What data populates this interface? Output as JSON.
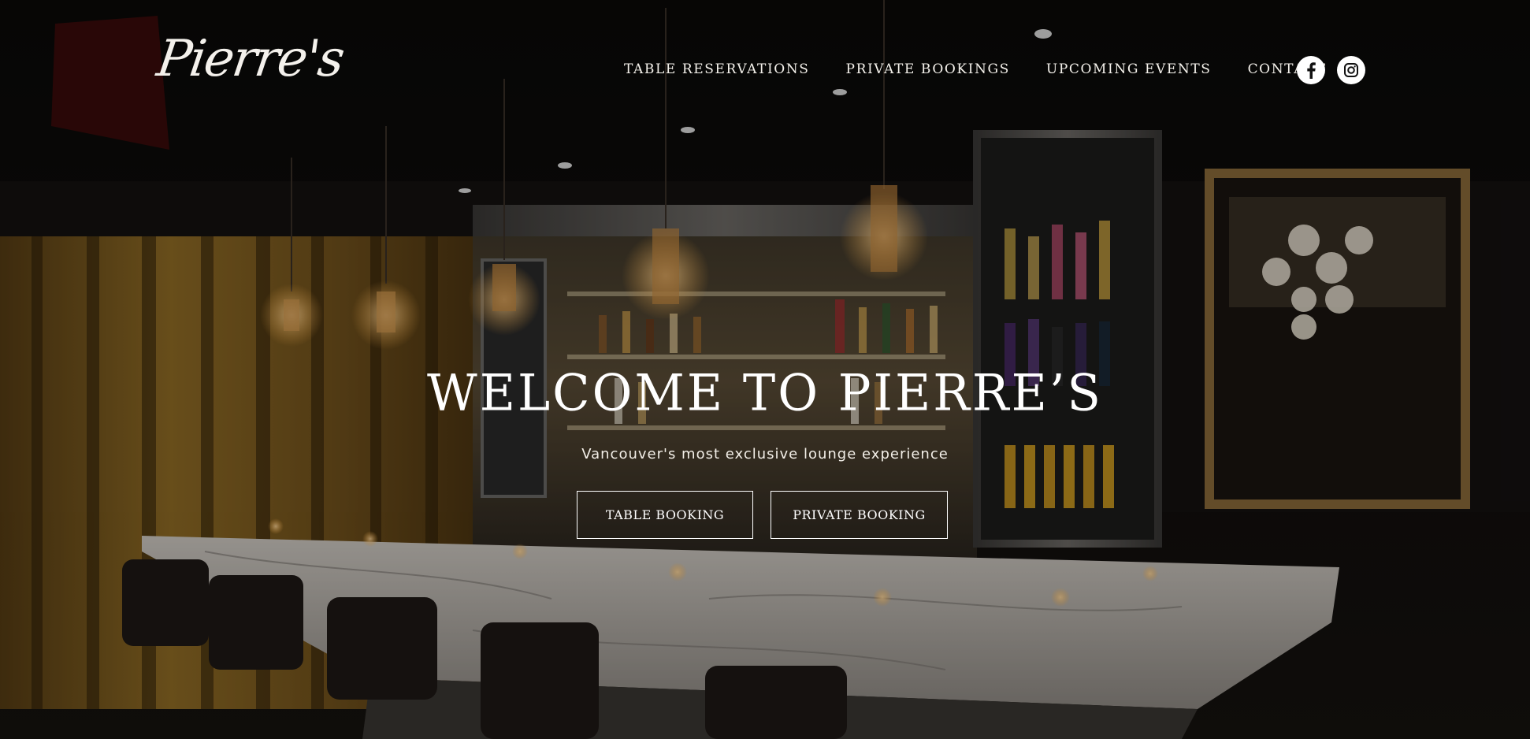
{
  "brand": {
    "logo_text": "Pierre's"
  },
  "nav": {
    "items": [
      {
        "label": "TABLE RESERVATIONS"
      },
      {
        "label": "PRIVATE BOOKINGS"
      },
      {
        "label": "UPCOMING EVENTS"
      },
      {
        "label": "CONTACT"
      }
    ]
  },
  "social": {
    "icons": [
      "facebook-icon",
      "instagram-icon"
    ]
  },
  "hero": {
    "headline": "WELCOME TO PIERRE’S",
    "subheadline": "Vancouver's most exclusive lounge experience",
    "buttons": [
      {
        "label": "TABLE BOOKING"
      },
      {
        "label": "PRIVATE BOOKING"
      }
    ]
  },
  "colors": {
    "text": "#ffffff",
    "background": "#0b0907",
    "gold_accent": "#b58a2a"
  }
}
